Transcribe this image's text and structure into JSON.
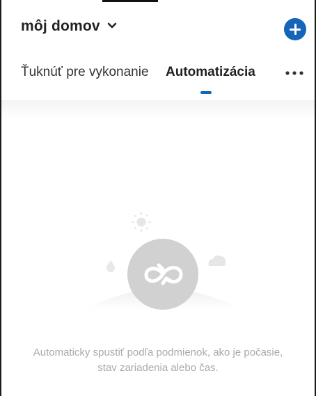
{
  "header": {
    "home_name": "môj domov",
    "home_dropdown_icon": "chevron-down-icon",
    "add_icon": "plus-circle-icon"
  },
  "tabs": [
    {
      "label": "Ťuknúť pre vykonanie",
      "active": false
    },
    {
      "label": "Automatizácia",
      "active": true
    }
  ],
  "more_icon": "more-horizontal-icon",
  "empty_state": {
    "icon": "automation-loop-icon",
    "message": "Automaticky spustiť podľa podmienok, ako je počasie, stav zariadenia alebo čas."
  },
  "colors": {
    "accent": "#1464ba",
    "text": "#222222",
    "muted_text": "#aaaaaa"
  }
}
